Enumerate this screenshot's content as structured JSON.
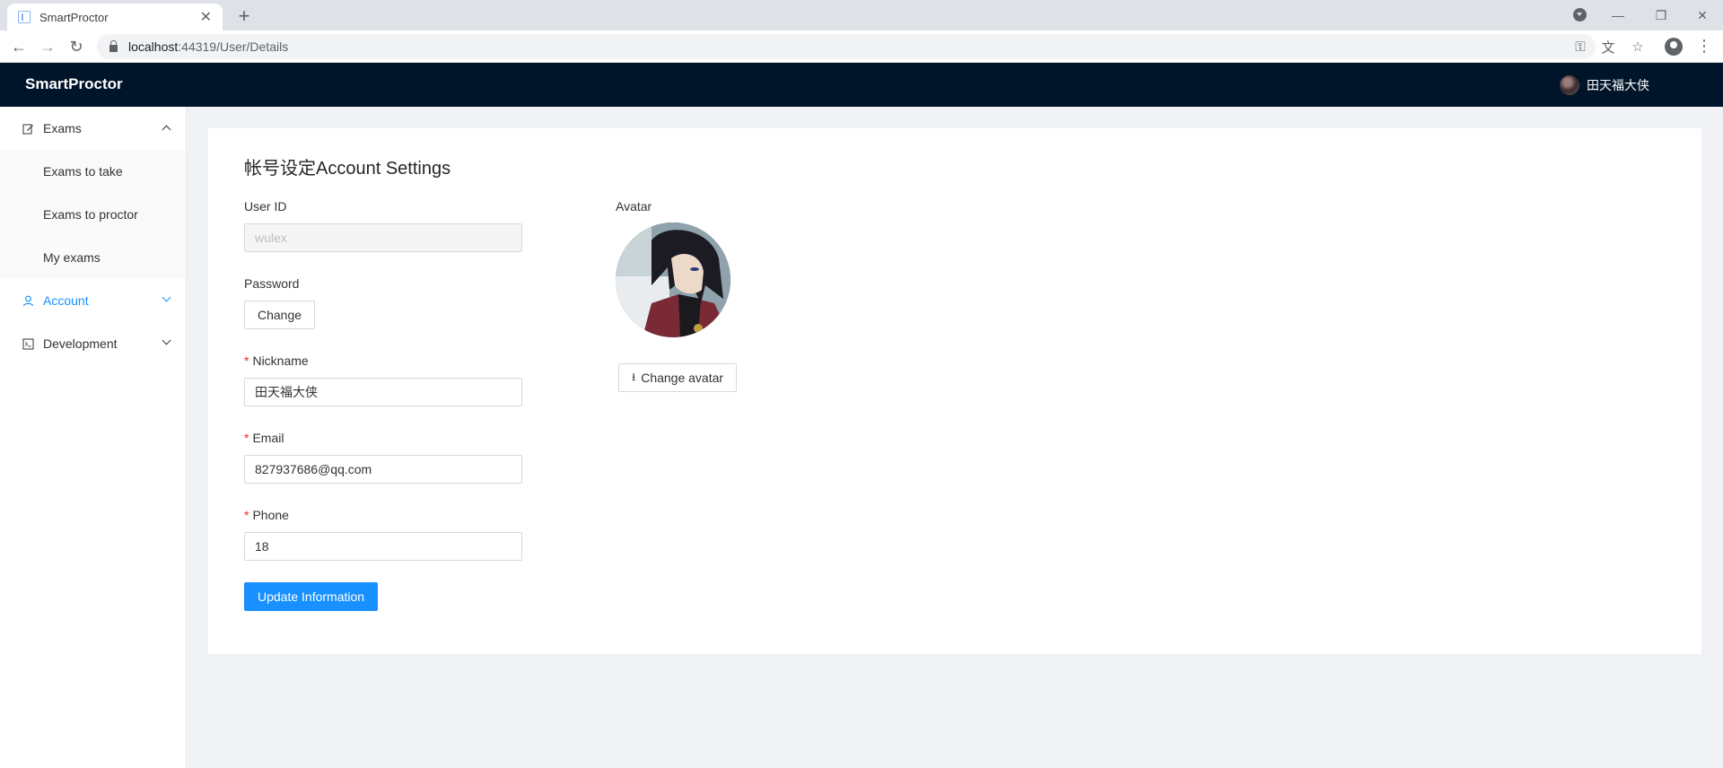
{
  "browser": {
    "tab_title": "SmartProctor",
    "url_host": "localhost",
    "url_path": ":44319/User/Details"
  },
  "header": {
    "brand": "SmartProctor",
    "username": "田天福大侠"
  },
  "sidebar": {
    "items": [
      {
        "label": "Exams",
        "icon": "edit-icon",
        "expanded": true
      },
      {
        "label": "Exams to take"
      },
      {
        "label": "Exams to proctor"
      },
      {
        "label": "My exams"
      },
      {
        "label": "Account",
        "icon": "user-icon",
        "expanded": false,
        "active": true
      },
      {
        "label": "Development",
        "icon": "code-icon",
        "expanded": false
      }
    ]
  },
  "form": {
    "title": "帐号设定Account Settings",
    "user_id_label": "User ID",
    "user_id_value": "wulex",
    "password_label": "Password",
    "password_button": "Change",
    "nickname_label": "Nickname",
    "nickname_value": "田天福大侠",
    "email_label": "Email",
    "email_value": "827937686@qq.com",
    "phone_label": "Phone",
    "phone_value": "18",
    "submit_button": "Update Information",
    "required_mark": "*"
  },
  "avatar": {
    "label": "Avatar",
    "change_button": "Change avatar"
  },
  "colors": {
    "header_bg": "#001529",
    "primary": "#1890ff",
    "required": "#f5222d"
  }
}
